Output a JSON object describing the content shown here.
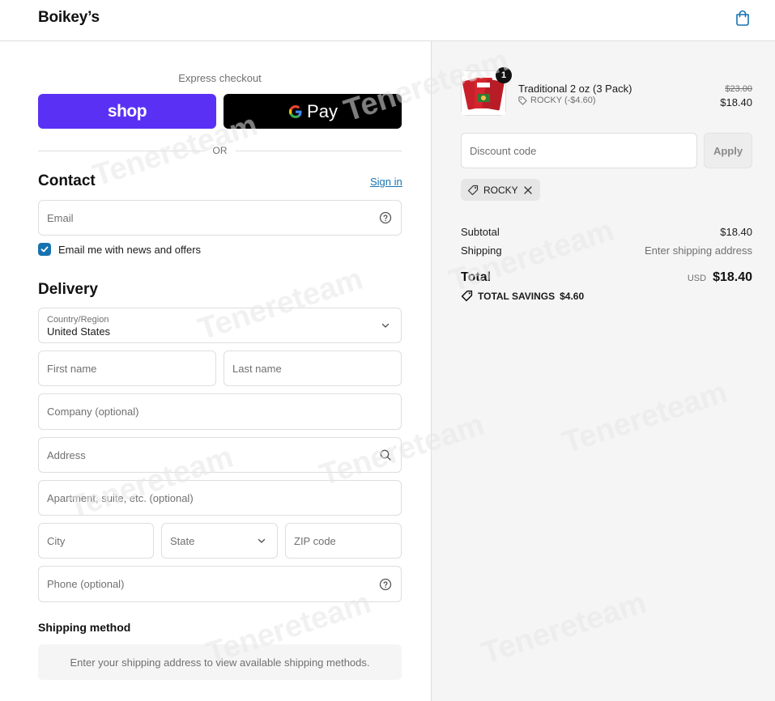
{
  "header": {
    "brand": "Boikey’s",
    "cart_icon": "shopping-bag-icon"
  },
  "express": {
    "label": "Express checkout",
    "shop_label": "shop",
    "gpay_label": "Pay",
    "or_label": "OR"
  },
  "contact": {
    "title": "Contact",
    "sign_in": "Sign in",
    "email_placeholder": "Email",
    "newsletter_label": "Email me with news and offers",
    "newsletter_checked": true
  },
  "delivery": {
    "title": "Delivery",
    "country_label": "Country/Region",
    "country_value": "United States",
    "first_name": "First name",
    "last_name": "Last name",
    "company": "Company (optional)",
    "address": "Address",
    "apartment": "Apartment, suite, etc. (optional)",
    "city": "City",
    "state": "State",
    "zip": "ZIP code",
    "phone": "Phone (optional)"
  },
  "shipping_method": {
    "title": "Shipping method",
    "message": "Enter your shipping address to view available shipping methods."
  },
  "summary": {
    "item": {
      "name": "Traditional 2 oz (3 Pack)",
      "quantity": "1",
      "discount": "ROCKY (-$4.60)",
      "original_price": "$23.00",
      "price": "$18.40"
    },
    "discount_placeholder": "Discount code",
    "apply_label": "Apply",
    "applied_code": "ROCKY",
    "subtotal_label": "Subtotal",
    "subtotal_value": "$18.40",
    "shipping_label": "Shipping",
    "shipping_value": "Enter shipping address",
    "total_label": "Total",
    "currency": "USD",
    "total_value": "$18.40",
    "savings_label": "TOTAL SAVINGS",
    "savings_value": "$4.60"
  },
  "watermark_text": "Tenereteam",
  "colors": {
    "shop_purple": "#5a31f4",
    "link_blue": "#1773b0",
    "border": "#dedede",
    "sidebar_bg": "#f5f5f5"
  }
}
